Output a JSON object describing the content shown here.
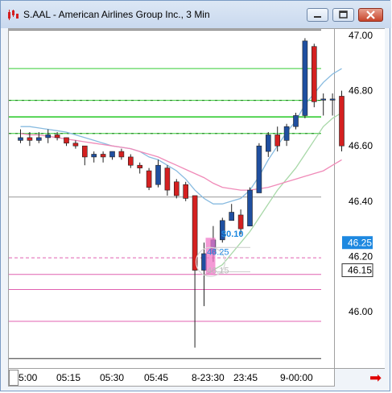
{
  "window": {
    "title": "S.AAL - American Airlines Group Inc., 3 Min",
    "icon": "candlestick-app-icon",
    "buttons": [
      "minimize-icon",
      "maximize-icon",
      "close-icon"
    ]
  },
  "colors": {
    "up": "#1f4fa0",
    "down": "#d42020",
    "level_green": "#33cc33",
    "level_pink": "#e060b0",
    "level_gray": "#999999",
    "ma_fast": "#88bbe0",
    "ma_mid": "#a8d8a8",
    "ma_slow": "#f08ab8",
    "price_marker_bg": "#1d88e0"
  },
  "price_axis": {
    "labels": [
      "47.00",
      "46.80",
      "46.60",
      "46.40",
      "46.20",
      "46.00"
    ],
    "current_price": "46.25",
    "last_marker": "46.15"
  },
  "time_axis": {
    "labels": [
      "5:00",
      "05:15",
      "05:30",
      "05:45",
      "8-23:30",
      "23:45",
      "9-00:00"
    ]
  },
  "annotations": {
    "profit_label": "$0.10",
    "entry_price": "46.25",
    "stop_price": "46.15"
  },
  "chart_data": {
    "type": "candlestick",
    "title": "S.AAL - American Airlines Group Inc., 3 Min",
    "ylim": [
      45.81,
      47.03
    ],
    "candles": [
      {
        "o": 46.62,
        "h": 46.66,
        "l": 46.61,
        "c": 46.63
      },
      {
        "o": 46.63,
        "h": 46.65,
        "l": 46.6,
        "c": 46.62
      },
      {
        "o": 46.62,
        "h": 46.65,
        "l": 46.61,
        "c": 46.63
      },
      {
        "o": 46.63,
        "h": 46.66,
        "l": 46.61,
        "c": 46.64
      },
      {
        "o": 46.64,
        "h": 46.65,
        "l": 46.62,
        "c": 46.63
      },
      {
        "o": 46.63,
        "h": 46.63,
        "l": 46.6,
        "c": 46.61
      },
      {
        "o": 46.61,
        "h": 46.62,
        "l": 46.59,
        "c": 46.6
      },
      {
        "o": 46.6,
        "h": 46.6,
        "l": 46.53,
        "c": 46.56
      },
      {
        "o": 46.56,
        "h": 46.58,
        "l": 46.54,
        "c": 46.57
      },
      {
        "o": 46.57,
        "h": 46.58,
        "l": 46.54,
        "c": 46.56
      },
      {
        "o": 46.56,
        "h": 46.58,
        "l": 46.55,
        "c": 46.58
      },
      {
        "o": 46.58,
        "h": 46.59,
        "l": 46.55,
        "c": 46.56
      },
      {
        "o": 46.56,
        "h": 46.57,
        "l": 46.52,
        "c": 46.53
      },
      {
        "o": 46.53,
        "h": 46.54,
        "l": 46.5,
        "c": 46.52
      },
      {
        "o": 46.51,
        "h": 46.52,
        "l": 46.44,
        "c": 46.45
      },
      {
        "o": 46.46,
        "h": 46.55,
        "l": 46.45,
        "c": 46.53
      },
      {
        "o": 46.52,
        "h": 46.53,
        "l": 46.42,
        "c": 46.44
      },
      {
        "o": 46.47,
        "h": 46.48,
        "l": 46.41,
        "c": 46.42
      },
      {
        "o": 46.46,
        "h": 46.47,
        "l": 46.4,
        "c": 46.41
      },
      {
        "o": 46.42,
        "h": 46.42,
        "l": 45.87,
        "c": 46.15
      },
      {
        "o": 46.15,
        "h": 46.25,
        "l": 46.02,
        "c": 46.21
      },
      {
        "o": 46.21,
        "h": 46.31,
        "l": 46.18,
        "c": 46.26
      },
      {
        "o": 46.26,
        "h": 46.34,
        "l": 46.25,
        "c": 46.33
      },
      {
        "o": 46.33,
        "h": 46.39,
        "l": 46.33,
        "c": 46.36
      },
      {
        "o": 46.35,
        "h": 46.37,
        "l": 46.28,
        "c": 46.3
      },
      {
        "o": 46.31,
        "h": 46.45,
        "l": 46.31,
        "c": 46.44
      },
      {
        "o": 46.43,
        "h": 46.61,
        "l": 46.44,
        "c": 46.6
      },
      {
        "o": 46.58,
        "h": 46.65,
        "l": 46.56,
        "c": 46.64
      },
      {
        "o": 46.64,
        "h": 46.67,
        "l": 46.58,
        "c": 46.6
      },
      {
        "o": 46.62,
        "h": 46.68,
        "l": 46.6,
        "c": 46.67
      },
      {
        "o": 46.67,
        "h": 46.72,
        "l": 46.66,
        "c": 46.71
      },
      {
        "o": 46.71,
        "h": 46.99,
        "l": 46.7,
        "c": 46.98
      },
      {
        "o": 46.96,
        "h": 46.97,
        "l": 46.74,
        "c": 46.76
      },
      {
        "o": 46.77,
        "h": 46.79,
        "l": 46.71,
        "c": 46.77
      },
      {
        "o": 46.77,
        "h": 46.79,
        "l": 46.71,
        "c": 46.77
      },
      {
        "o": 46.78,
        "h": 46.8,
        "l": 46.58,
        "c": 46.6
      }
    ],
    "levels": [
      {
        "price": 46.88,
        "color": "green"
      },
      {
        "price": 46.765,
        "color": "green"
      },
      {
        "price": 46.705,
        "color": "green"
      },
      {
        "price": 46.645,
        "color": "green"
      },
      {
        "price": 46.415,
        "color": "gray"
      },
      {
        "price": 46.195,
        "color": "pink"
      },
      {
        "price": 46.135,
        "color": "pink"
      },
      {
        "price": 46.08,
        "color": "pink"
      },
      {
        "price": 45.965,
        "color": "pink"
      },
      {
        "price": 47.02,
        "color": "gray"
      },
      {
        "price": 45.83,
        "color": "gray"
      }
    ],
    "moving_averages": [
      {
        "name": "",
        "color": "ma_fast",
        "values": [
          46.67,
          46.67,
          46.665,
          46.66,
          46.655,
          46.65,
          46.64,
          46.63,
          46.62,
          46.61,
          46.6,
          46.595,
          46.59,
          46.58,
          46.56,
          46.55,
          46.53,
          46.51,
          46.48,
          46.44,
          46.41,
          46.39,
          46.39,
          46.4,
          46.41,
          46.44,
          46.49,
          46.55,
          46.6,
          46.65,
          46.69,
          46.75,
          46.79,
          46.83,
          46.86,
          46.88
        ]
      },
      {
        "name": "",
        "color": "ma_mid",
        "values": [
          null,
          null,
          null,
          null,
          null,
          null,
          null,
          null,
          null,
          null,
          null,
          null,
          null,
          null,
          null,
          null,
          null,
          null,
          null,
          null,
          46.13,
          46.15,
          46.17,
          46.21,
          46.25,
          46.29,
          46.34,
          46.39,
          46.44,
          46.48,
          46.52,
          46.57,
          46.62,
          46.67,
          46.7,
          46.72
        ]
      },
      {
        "name": "",
        "color": "ma_slow",
        "values": [
          46.645,
          46.64,
          46.64,
          46.635,
          46.63,
          46.625,
          46.62,
          46.615,
          46.61,
          46.605,
          46.6,
          46.595,
          46.59,
          46.58,
          46.57,
          46.56,
          46.545,
          46.53,
          46.515,
          46.5,
          46.485,
          46.465,
          46.45,
          46.445,
          46.44,
          46.44,
          46.445,
          46.45,
          46.46,
          46.47,
          46.48,
          46.49,
          46.5,
          46.51,
          46.53,
          46.55
        ]
      }
    ]
  }
}
